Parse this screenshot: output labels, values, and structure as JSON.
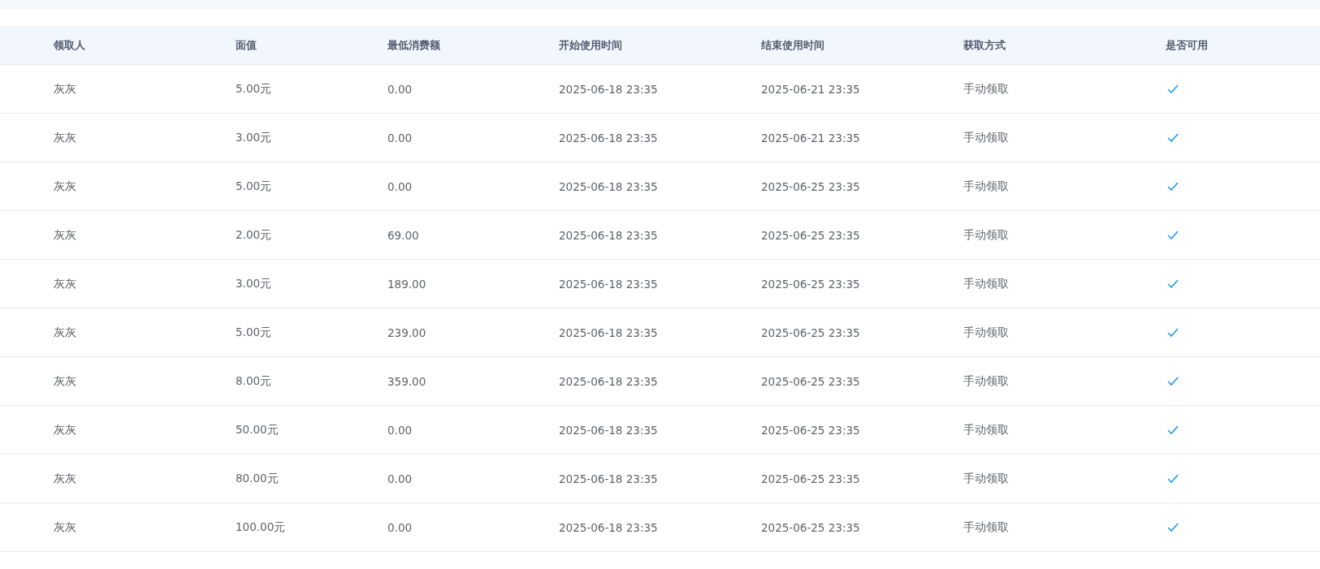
{
  "table": {
    "columns": [
      "领取人",
      "面值",
      "最低消费额",
      "开始使用时间",
      "结束使用时间",
      "获取方式",
      "是否可用"
    ],
    "rows": [
      {
        "recipient": "灰灰",
        "value": "5.00元",
        "min_spend": "0.00",
        "start": "2025-06-18 23:35",
        "end": "2025-06-21 23:35",
        "method": "手动领取",
        "available": true
      },
      {
        "recipient": "灰灰",
        "value": "3.00元",
        "min_spend": "0.00",
        "start": "2025-06-18 23:35",
        "end": "2025-06-21 23:35",
        "method": "手动领取",
        "available": true
      },
      {
        "recipient": "灰灰",
        "value": "5.00元",
        "min_spend": "0.00",
        "start": "2025-06-18 23:35",
        "end": "2025-06-25 23:35",
        "method": "手动领取",
        "available": true
      },
      {
        "recipient": "灰灰",
        "value": "2.00元",
        "min_spend": "69.00",
        "start": "2025-06-18 23:35",
        "end": "2025-06-25 23:35",
        "method": "手动领取",
        "available": true
      },
      {
        "recipient": "灰灰",
        "value": "3.00元",
        "min_spend": "189.00",
        "start": "2025-06-18 23:35",
        "end": "2025-06-25 23:35",
        "method": "手动领取",
        "available": true
      },
      {
        "recipient": "灰灰",
        "value": "5.00元",
        "min_spend": "239.00",
        "start": "2025-06-18 23:35",
        "end": "2025-06-25 23:35",
        "method": "手动领取",
        "available": true
      },
      {
        "recipient": "灰灰",
        "value": "8.00元",
        "min_spend": "359.00",
        "start": "2025-06-18 23:35",
        "end": "2025-06-25 23:35",
        "method": "手动领取",
        "available": true
      },
      {
        "recipient": "灰灰",
        "value": "50.00元",
        "min_spend": "0.00",
        "start": "2025-06-18 23:35",
        "end": "2025-06-25 23:35",
        "method": "手动领取",
        "available": true
      },
      {
        "recipient": "灰灰",
        "value": "80.00元",
        "min_spend": "0.00",
        "start": "2025-06-18 23:35",
        "end": "2025-06-25 23:35",
        "method": "手动领取",
        "available": true
      },
      {
        "recipient": "灰灰",
        "value": "100.00元",
        "min_spend": "0.00",
        "start": "2025-06-18 23:35",
        "end": "2025-06-25 23:35",
        "method": "手动领取",
        "available": true
      }
    ]
  }
}
